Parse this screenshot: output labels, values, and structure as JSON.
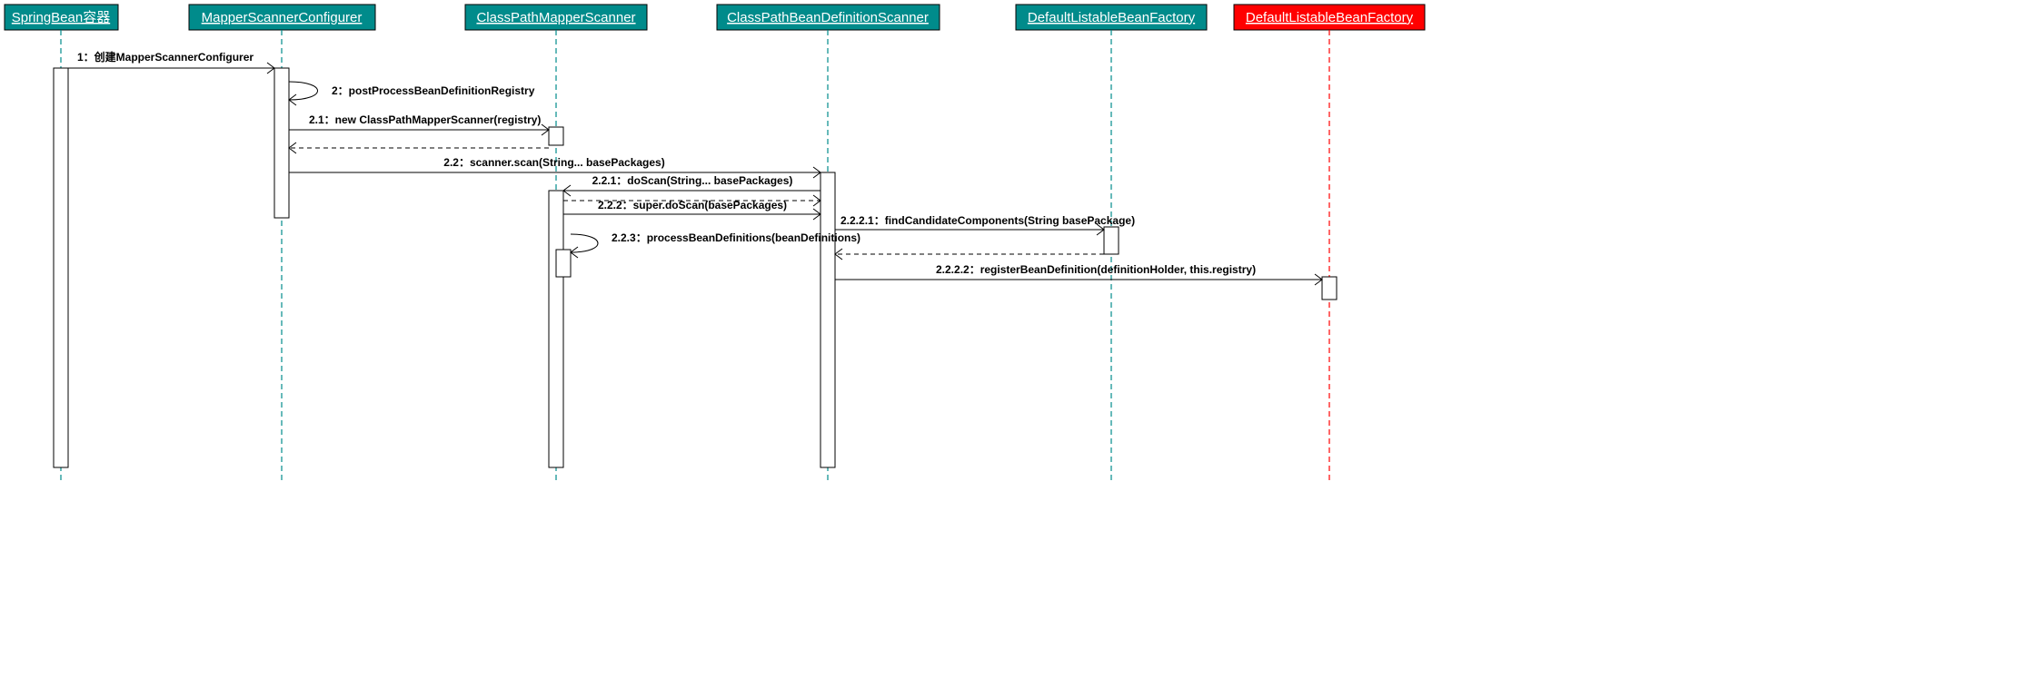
{
  "participants": {
    "p1": {
      "label": "SpringBean容器",
      "color": "teal"
    },
    "p2": {
      "label": "MapperScannerConfigurer",
      "color": "teal"
    },
    "p3": {
      "label": "ClassPathMapperScanner",
      "color": "teal"
    },
    "p4": {
      "label": "ClassPathBeanDefinitionScanner",
      "color": "teal"
    },
    "p5": {
      "label": "DefaultListableBeanFactory",
      "color": "teal"
    },
    "p6": {
      "label": "DefaultListableBeanFactory",
      "color": "red"
    }
  },
  "messages": {
    "m1": "1：创建MapperScannerConfigurer",
    "m2": "2：postProcessBeanDefinitionRegistry",
    "m21": "2.1：new ClassPathMapperScanner(registry)",
    "m22": "2.2：scanner.scan(String... basePackages)",
    "m221": "2.2.1：doScan(String... basePackages)",
    "m222": "2.2.2：super.doScan(basePackages)",
    "m223": "2.2.3：processBeanDefinitions(beanDefinitions)",
    "m2221": "2.2.2.1：findCandidateComponents(String basePackage)",
    "m2222": "2.2.2.2：registerBeanDefinition(definitionHolder, this.registry)"
  }
}
